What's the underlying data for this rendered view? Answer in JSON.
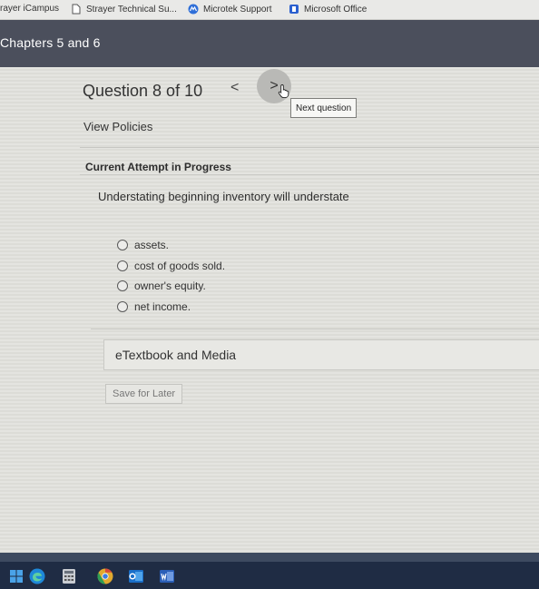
{
  "bookmarks": [
    {
      "label": "rayer iCampus",
      "icon": "none"
    },
    {
      "label": "Strayer Technical Su...",
      "icon": "page-icon"
    },
    {
      "label": "Microtek Support",
      "icon": "microtek-icon"
    },
    {
      "label": "Microsoft Office",
      "icon": "office-icon"
    }
  ],
  "header": {
    "title": "Chapters 5 and 6"
  },
  "question_nav": {
    "counter": "Question 8 of 10",
    "prev_glyph": "<",
    "next_glyph": ">",
    "tooltip": "Next question"
  },
  "view_policies": "View Policies",
  "attempt_status": "Current Attempt in Progress",
  "question": {
    "text": "Understating beginning inventory will understate",
    "options": [
      "assets.",
      "cost of goods sold.",
      "owner's equity.",
      "net income."
    ]
  },
  "etextbook": "eTextbook and Media",
  "save_later": "Save for Later",
  "colors": {
    "header_bg": "#4b4f5c",
    "taskbar_bg": "#1f2c44",
    "page_bg": "#dcdcd8"
  },
  "taskbar_icons": [
    "windows-start-icon",
    "edge-icon",
    "calculator-icon",
    "chrome-icon",
    "outlook-icon",
    "word-icon"
  ]
}
